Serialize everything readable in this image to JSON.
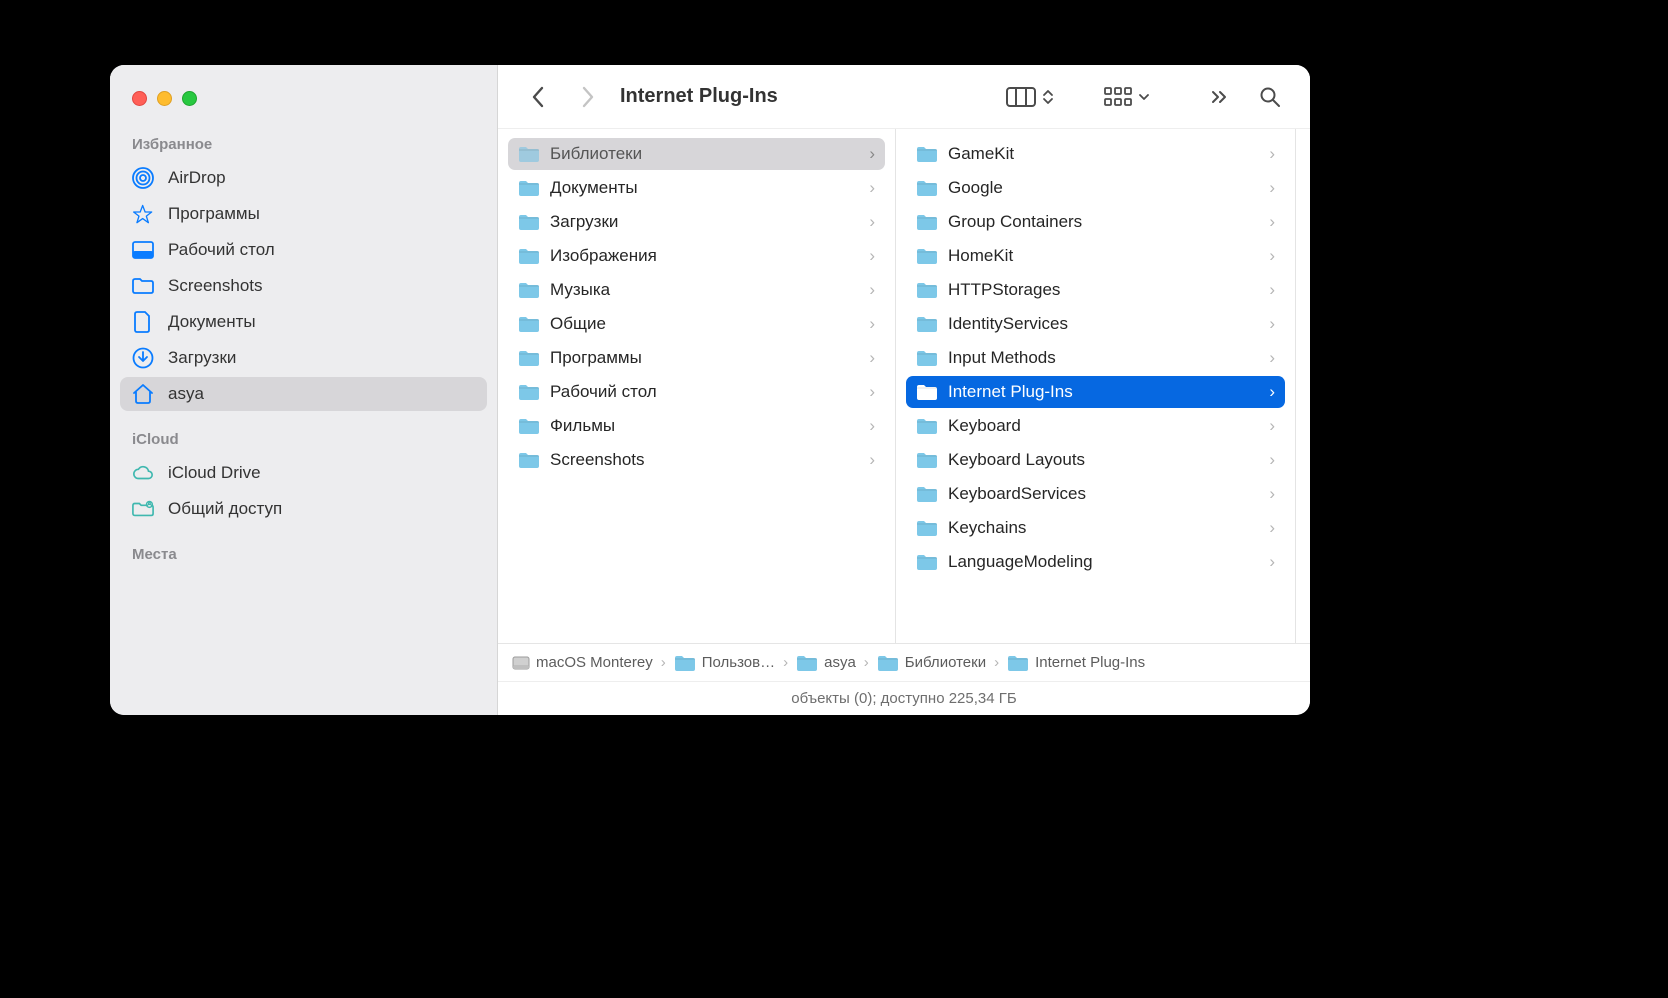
{
  "header": {
    "title": "Internet Plug-Ins"
  },
  "sidebar": {
    "sections": [
      {
        "title": "Избранное",
        "items": [
          {
            "label": "AirDrop",
            "icon": "airdrop",
            "selected": false
          },
          {
            "label": "Программы",
            "icon": "apps",
            "selected": false
          },
          {
            "label": "Рабочий стол",
            "icon": "desktop",
            "selected": false
          },
          {
            "label": "Screenshots",
            "icon": "folder",
            "selected": false
          },
          {
            "label": "Документы",
            "icon": "document",
            "selected": false
          },
          {
            "label": "Загрузки",
            "icon": "downloads",
            "selected": false
          },
          {
            "label": "asya",
            "icon": "home",
            "selected": true
          }
        ]
      },
      {
        "title": "iCloud",
        "items": [
          {
            "label": "iCloud Drive",
            "icon": "cloud",
            "selected": false
          },
          {
            "label": "Общий доступ",
            "icon": "shared",
            "selected": false
          }
        ]
      },
      {
        "title": "Места",
        "items": []
      }
    ]
  },
  "columns": {
    "c1": [
      {
        "label": "Библиотеки",
        "selected": true,
        "hasChildren": true
      },
      {
        "label": "Документы",
        "selected": false,
        "hasChildren": true
      },
      {
        "label": "Загрузки",
        "selected": false,
        "hasChildren": true
      },
      {
        "label": "Изображения",
        "selected": false,
        "hasChildren": true
      },
      {
        "label": "Музыка",
        "selected": false,
        "hasChildren": true
      },
      {
        "label": "Общие",
        "selected": false,
        "hasChildren": true
      },
      {
        "label": "Программы",
        "selected": false,
        "hasChildren": true
      },
      {
        "label": "Рабочий стол",
        "selected": false,
        "hasChildren": true
      },
      {
        "label": "Фильмы",
        "selected": false,
        "hasChildren": true
      },
      {
        "label": "Screenshots",
        "selected": false,
        "hasChildren": true
      }
    ],
    "c2": [
      {
        "label": "GameKit",
        "selected": false,
        "hasChildren": true
      },
      {
        "label": "Google",
        "selected": false,
        "hasChildren": true
      },
      {
        "label": "Group Containers",
        "selected": false,
        "hasChildren": true
      },
      {
        "label": "HomeKit",
        "selected": false,
        "hasChildren": true
      },
      {
        "label": "HTTPStorages",
        "selected": false,
        "hasChildren": true
      },
      {
        "label": "IdentityServices",
        "selected": false,
        "hasChildren": true
      },
      {
        "label": "Input Methods",
        "selected": false,
        "hasChildren": true
      },
      {
        "label": "Internet Plug-Ins",
        "selected": true,
        "hasChildren": true
      },
      {
        "label": "Keyboard",
        "selected": false,
        "hasChildren": true
      },
      {
        "label": "Keyboard Layouts",
        "selected": false,
        "hasChildren": true
      },
      {
        "label": "KeyboardServices",
        "selected": false,
        "hasChildren": true
      },
      {
        "label": "Keychains",
        "selected": false,
        "hasChildren": true
      },
      {
        "label": "LanguageModeling",
        "selected": false,
        "hasChildren": true
      }
    ]
  },
  "path": [
    {
      "label": "macOS Monterey",
      "icon": "disk"
    },
    {
      "label": "Пользов",
      "icon": "folder",
      "truncated": true
    },
    {
      "label": "asya",
      "icon": "folder"
    },
    {
      "label": "Библиотеки",
      "icon": "folder"
    },
    {
      "label": "Internet Plug-Ins",
      "icon": "folder"
    }
  ],
  "status": {
    "text": "объекты (0); доступно 225,34 ГБ"
  }
}
